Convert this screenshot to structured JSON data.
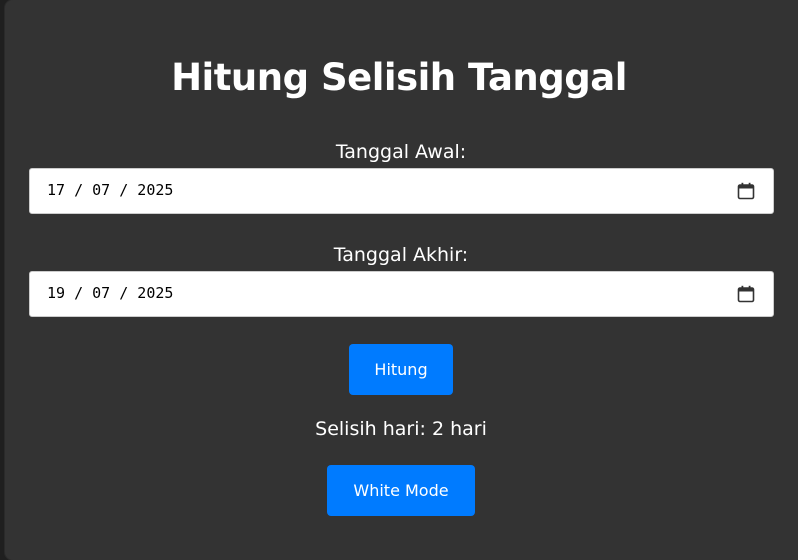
{
  "title": "Hitung Selisih Tanggal",
  "start": {
    "label": "Tanggal Awal:",
    "value": "17 / 07 / 2025"
  },
  "end": {
    "label": "Tanggal Akhir:",
    "value": "19 / 07 / 2025"
  },
  "calculate_button": "Hitung",
  "result": "Selisih hari: 2 hari",
  "mode_button": "White Mode",
  "colors": {
    "background": "#333333",
    "accent": "#007bff",
    "text": "#ffffff"
  },
  "icons": {
    "date_picker": "calendar-icon"
  }
}
